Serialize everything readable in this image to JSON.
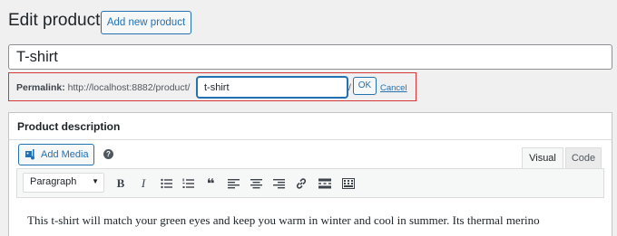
{
  "header": {
    "title": "Edit product",
    "add_new_label": "Add new product"
  },
  "product": {
    "title_value": "T-shirt"
  },
  "permalink": {
    "label": "Permalink:",
    "base_url": "http://localhost:8882/product/",
    "slug_value": "t-shirt",
    "suffix": "/",
    "ok_label": "OK",
    "cancel_label": "Cancel",
    "highlight_color": "#d63638"
  },
  "description": {
    "heading": "Product description",
    "add_media_label": "Add Media",
    "help_icon": "?",
    "tabs": {
      "visual": "Visual",
      "code": "Code"
    },
    "format_select_value": "Paragraph",
    "toolbar_icons": [
      "bold-icon",
      "italic-icon",
      "bullet-list-icon",
      "numbered-list-icon",
      "blockquote-icon",
      "align-left-icon",
      "align-center-icon",
      "align-right-icon",
      "link-icon",
      "read-more-icon",
      "toolbar-toggle-icon"
    ],
    "content_text": "This t-shirt will match your green eyes and keep you warm in winter and cool in summer. Its thermal merino"
  },
  "colors": {
    "accent": "#2271b1",
    "background": "#f0f0f1"
  }
}
